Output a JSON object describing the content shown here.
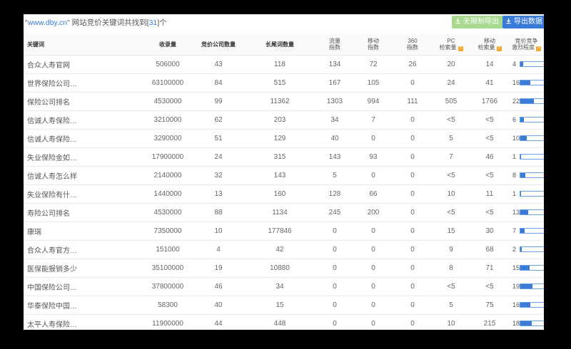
{
  "header": {
    "quote_open": "\"",
    "site": "www.dby.cn",
    "quote_close": "\"",
    "text_before": " 网站竞价关键词共找到[",
    "count": "31",
    "text_after": "]个"
  },
  "buttons": {
    "unlimited_export": "无限制导出",
    "export": "导出数据"
  },
  "columns": [
    "关键词",
    "收录量",
    "竞价公司数量",
    "长尾词数量",
    "流量指数",
    "移动指数",
    "360指数",
    "PC检索量",
    "移动检索量",
    "竞价竞争激烈程度"
  ],
  "column_lines": {
    "flow": [
      "流量",
      "指数"
    ],
    "mobile": [
      "移动",
      "指数"
    ],
    "s360": [
      "360",
      "指数"
    ],
    "pc": [
      "PC",
      "检索量"
    ],
    "mobile_search": [
      "移动",
      "检索量"
    ],
    "competition": [
      "竞价竞争",
      "激烈程度"
    ]
  },
  "help_icon_glyph": "?",
  "rows": [
    {
      "keyword": "合众人寿官网",
      "index": "506000",
      "companies": "43",
      "longtail": "118",
      "flow": "134",
      "mobile": "72",
      "s360": "26",
      "pc": "20",
      "mobile_search": "14",
      "competition": 4
    },
    {
      "keyword": "世界保险公司…",
      "index": "63100000",
      "companies": "84",
      "longtail": "515",
      "flow": "167",
      "mobile": "105",
      "s360": "0",
      "pc": "24",
      "mobile_search": "41",
      "competition": 16
    },
    {
      "keyword": "保险公司排名",
      "index": "4530000",
      "companies": "99",
      "longtail": "11362",
      "flow": "1303",
      "mobile": "994",
      "s360": "111",
      "pc": "505",
      "mobile_search": "1766",
      "competition": 22
    },
    {
      "keyword": "信诚人寿保险…",
      "index": "3210000",
      "companies": "62",
      "longtail": "203",
      "flow": "34",
      "mobile": "7",
      "s360": "0",
      "pc": "<5",
      "mobile_search": "<5",
      "competition": 6
    },
    {
      "keyword": "信诚人寿保险…",
      "index": "3290000",
      "companies": "51",
      "longtail": "129",
      "flow": "40",
      "mobile": "0",
      "s360": "0",
      "pc": "5",
      "mobile_search": "<5",
      "competition": 10
    },
    {
      "keyword": "失业保险金如…",
      "index": "17900000",
      "companies": "24",
      "longtail": "315",
      "flow": "143",
      "mobile": "93",
      "s360": "0",
      "pc": "7",
      "mobile_search": "46",
      "competition": 1
    },
    {
      "keyword": "信诚人寿怎么样",
      "index": "2140000",
      "companies": "32",
      "longtail": "143",
      "flow": "5",
      "mobile": "0",
      "s360": "0",
      "pc": "<5",
      "mobile_search": "<5",
      "competition": 8
    },
    {
      "keyword": "失业保险有什…",
      "index": "1440000",
      "companies": "13",
      "longtail": "160",
      "flow": "128",
      "mobile": "66",
      "s360": "0",
      "pc": "10",
      "mobile_search": "11",
      "competition": 1
    },
    {
      "keyword": "寿险公司排名",
      "index": "4530000",
      "companies": "88",
      "longtail": "1134",
      "flow": "245",
      "mobile": "200",
      "s360": "0",
      "pc": "<5",
      "mobile_search": "<5",
      "competition": 13
    },
    {
      "keyword": "康瑞",
      "index": "7350000",
      "companies": "10",
      "longtail": "177846",
      "flow": "0",
      "mobile": "0",
      "s360": "0",
      "pc": "15",
      "mobile_search": "30",
      "competition": 7
    },
    {
      "keyword": "合众人寿官方…",
      "index": "151000",
      "companies": "4",
      "longtail": "42",
      "flow": "0",
      "mobile": "0",
      "s360": "0",
      "pc": "9",
      "mobile_search": "68",
      "competition": 2
    },
    {
      "keyword": "医保能报销多少",
      "index": "35100000",
      "companies": "19",
      "longtail": "10880",
      "flow": "0",
      "mobile": "0",
      "s360": "0",
      "pc": "8",
      "mobile_search": "71",
      "competition": 15
    },
    {
      "keyword": "中国保险公司…",
      "index": "37800000",
      "companies": "46",
      "longtail": "34",
      "flow": "0",
      "mobile": "0",
      "s360": "0",
      "pc": "<5",
      "mobile_search": "<5",
      "competition": 19
    },
    {
      "keyword": "华泰保险中国…",
      "index": "58300",
      "companies": "40",
      "longtail": "15",
      "flow": "0",
      "mobile": "0",
      "s360": "0",
      "pc": "5",
      "mobile_search": "75",
      "competition": 16
    },
    {
      "keyword": "太平人寿保险…",
      "index": "11900000",
      "companies": "44",
      "longtail": "448",
      "flow": "0",
      "mobile": "0",
      "s360": "0",
      "pc": "10",
      "mobile_search": "215",
      "competition": 18
    }
  ],
  "colors": {
    "accent": "#3b7bd8",
    "unlimited_button": "#a7d98f",
    "help_icon": "#f0a830"
  }
}
